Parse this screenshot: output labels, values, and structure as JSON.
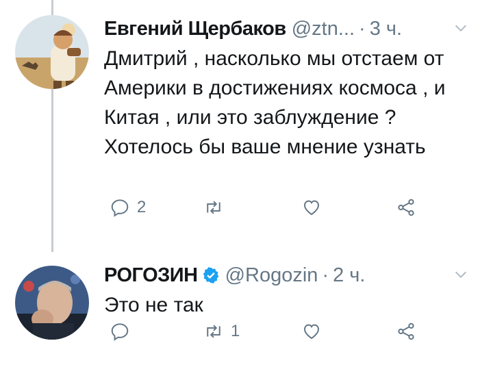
{
  "tweets": [
    {
      "name": "Евгений Щербаков",
      "handle": "@ztn...",
      "separator": "·",
      "time": "3 ч.",
      "text": "Дмитрий , насколько мы отстаем от Америки в достижениях космоса , и Китая , или это заблуждение ? Хотелось бы ваше мнение узнать",
      "reply_count": "2",
      "retweet_count": "",
      "like_count": ""
    },
    {
      "name": "РОГОЗИН",
      "verified": true,
      "handle": "@Rogozin",
      "separator": "·",
      "time": "2 ч.",
      "text": "Это не так",
      "reply_count": "",
      "retweet_count": "1",
      "like_count": ""
    }
  ],
  "colors": {
    "text": "#14171a",
    "secondary": "#657786",
    "verified": "#1da1f2",
    "thread_line": "#c7ccd1"
  }
}
